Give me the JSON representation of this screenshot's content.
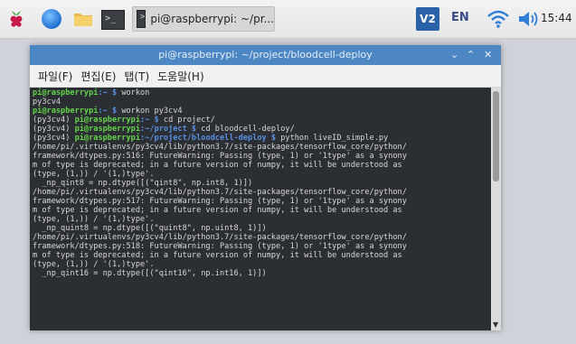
{
  "taskbar": {
    "task_label": "pi@raspberrypi: ~/pr...",
    "vnc_label": "V2",
    "language": "EN",
    "clock": "15:44",
    "term_glyph": ">_"
  },
  "window": {
    "title": "pi@raspberrypi: ~/project/bloodcell-deploy",
    "controls": [
      "⌄",
      "⌃",
      "✕"
    ],
    "menu": [
      "파일(F)",
      "편집(E)",
      "탭(T)",
      "도움말(H)"
    ]
  },
  "terminal": {
    "l1_user": "pi@raspberrypi",
    "l1_path": ":~ $ ",
    "l1_cmd": "workon",
    "l2": "py3cv4",
    "l3_user": "pi@raspberrypi",
    "l3_path": ":~ $ ",
    "l3_cmd": "workon py3cv4",
    "l4_env": "(py3cv4) ",
    "l4_user": "pi@raspberrypi",
    "l4_path": ":~ $ ",
    "l4_cmd": "cd project/",
    "l5_env": "(py3cv4) ",
    "l5_user": "pi@raspberrypi",
    "l5_path": ":~/project $ ",
    "l5_cmd": "cd bloodcell-deploy/",
    "l6_env": "(py3cv4) ",
    "l6_user": "pi@raspberrypi",
    "l6_path": ":~/project/bloodcell-deploy $ ",
    "l6_cmd": "python liveID_simple.py",
    "output": [
      "/home/pi/.virtualenvs/py3cv4/lib/python3.7/site-packages/tensorflow_core/python/",
      "framework/dtypes.py:516: FutureWarning: Passing (type, 1) or '1type' as a synony",
      "m of type is deprecated; in a future version of numpy, it will be understood as",
      "(type, (1,)) / '(1,)type'.",
      "  _np_qint8 = np.dtype([(\"qint8\", np.int8, 1)])",
      "/home/pi/.virtualenvs/py3cv4/lib/python3.7/site-packages/tensorflow_core/python/",
      "framework/dtypes.py:517: FutureWarning: Passing (type, 1) or '1type' as a synony",
      "m of type is deprecated; in a future version of numpy, it will be understood as",
      "(type, (1,)) / '(1,)type'.",
      "  _np_quint8 = np.dtype([(\"quint8\", np.uint8, 1)])",
      "/home/pi/.virtualenvs/py3cv4/lib/python3.7/site-packages/tensorflow_core/python/",
      "framework/dtypes.py:518: FutureWarning: Passing (type, 1) or '1type' as a synony",
      "m of type is deprecated; in a future version of numpy, it will be understood as",
      "(type, (1,)) / '(1,)type'.",
      "  _np_qint16 = np.dtype([(\"qint16\", np.int16, 1)])"
    ]
  }
}
